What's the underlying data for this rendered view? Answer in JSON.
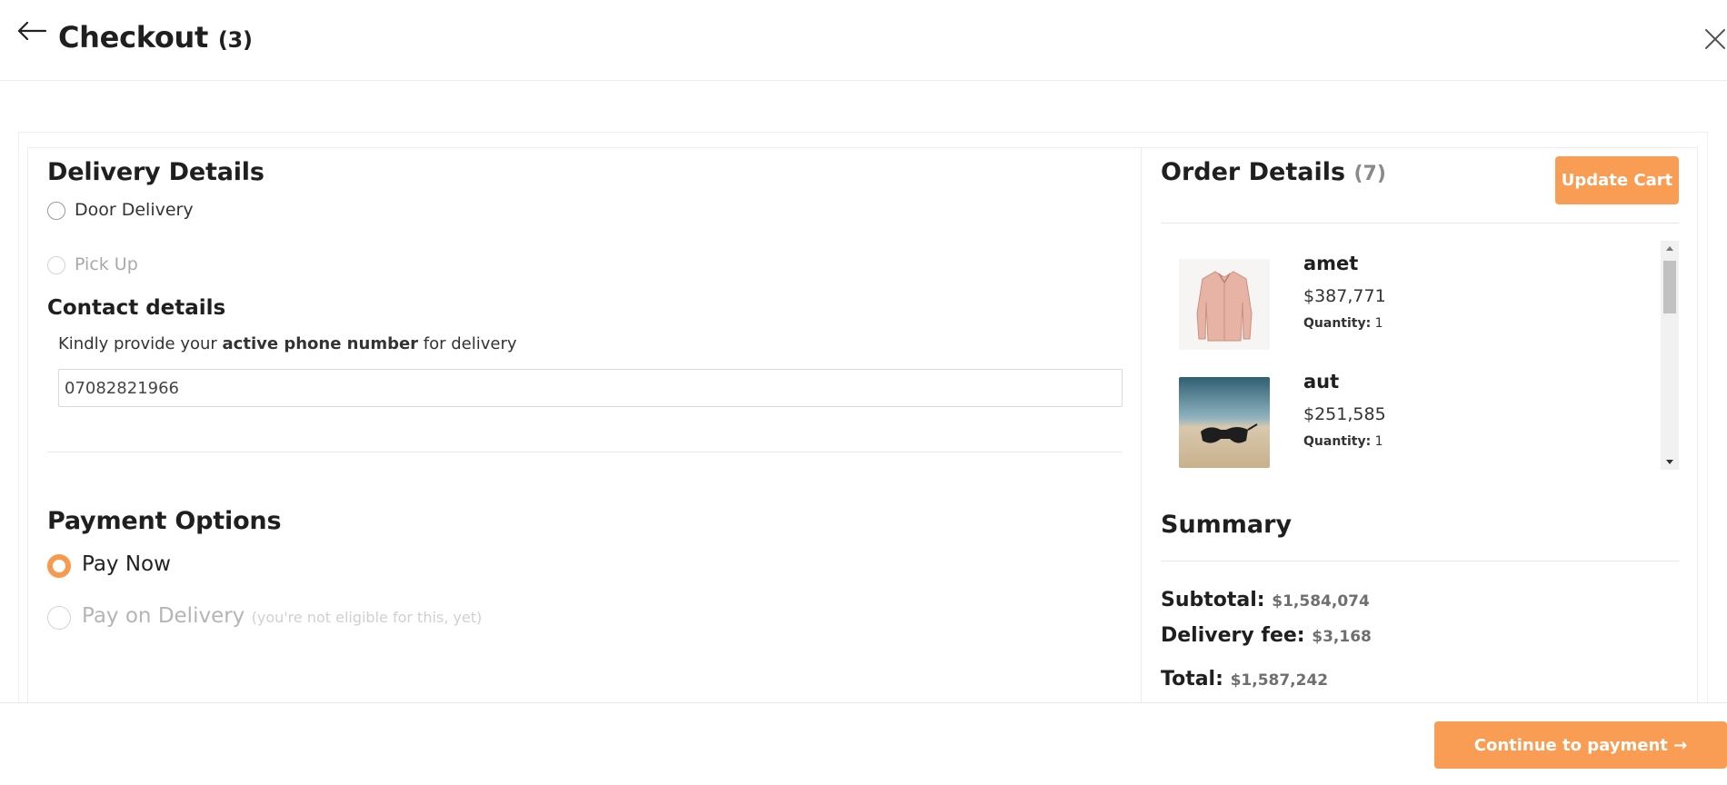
{
  "header": {
    "title": "Checkout",
    "count": "(3)"
  },
  "delivery": {
    "heading": "Delivery Details",
    "options": [
      {
        "label": "Door Delivery"
      },
      {
        "label": "Pick Up"
      }
    ]
  },
  "contact": {
    "heading": "Contact details",
    "helper_prefix": "Kindly provide your ",
    "helper_bold": "active phone number",
    "helper_suffix": " for delivery",
    "phone_value": "07082821966"
  },
  "payment": {
    "heading": "Payment Options",
    "pay_now": "Pay Now",
    "pay_on_delivery": "Pay on Delivery",
    "pay_on_delivery_note": "(you're not eligible for this, yet)"
  },
  "order": {
    "heading": "Order Details",
    "count": "(7)",
    "update_label": "Update Cart",
    "items": [
      {
        "name": "amet",
        "price": "$387,771",
        "qty_label": "Quantity:",
        "qty": "1"
      },
      {
        "name": "aut",
        "price": "$251,585",
        "qty_label": "Quantity:",
        "qty": "1"
      }
    ]
  },
  "summary": {
    "heading": "Summary",
    "subtotal_label": "Subtotal:",
    "subtotal": "$1,584,074",
    "delivery_label": "Delivery fee:",
    "delivery": "$3,168",
    "total_label": "Total:",
    "total": "$1,587,242"
  },
  "footer": {
    "continue_label": "Continue to payment →"
  },
  "colors": {
    "accent": "#f99d55",
    "radio_checked": "#f79a4f"
  },
  "icons": {
    "back": "arrow-left-icon",
    "close": "close-icon"
  }
}
